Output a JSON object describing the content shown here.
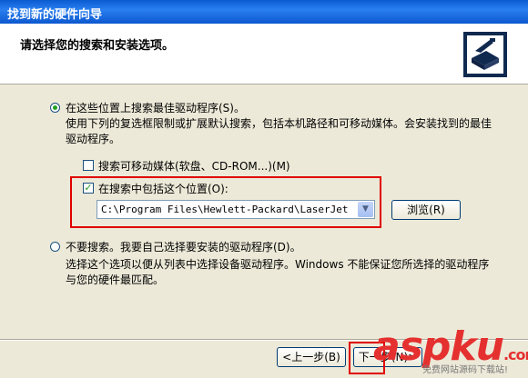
{
  "window": {
    "title": "找到新的硬件向导"
  },
  "header": {
    "heading": "请选择您的搜索和安装选项。",
    "icon": "hardware-install-icon"
  },
  "option_search": {
    "label": "在这些位置上搜索最佳驱动程序(S)。",
    "selected": true,
    "description": "使用下列的复选框限制或扩展默认搜索，包括本机路径和可移动媒体。会安装找到的最佳驱动程序。",
    "removable_media": {
      "label": "搜索可移动媒体(软盘、CD-ROM...)(M)",
      "checked": false
    },
    "include_location": {
      "label": "在搜索中包括这个位置(O):",
      "checked": true
    },
    "path_value": "C:\\Program Files\\Hewlett-Packard\\LaserJet",
    "browse_label": "浏览(R)"
  },
  "option_nosearch": {
    "label": "不要搜索。我要自己选择要安装的驱动程序(D)。",
    "selected": false,
    "description": "选择这个选项以便从列表中选择设备驱动程序。Windows 不能保证您所选择的驱动程序与您的硬件最匹配。"
  },
  "footer": {
    "back_label": "<上一步(B)",
    "next_label": "下一步(N)>"
  },
  "watermark": {
    "logo": "aspku",
    "suffix": ".com",
    "sub": "免费网站源码下载站!"
  },
  "colors": {
    "title_bar": "#0a5ad0",
    "highlight_box": "#e00000",
    "watermark": "#e53030"
  }
}
